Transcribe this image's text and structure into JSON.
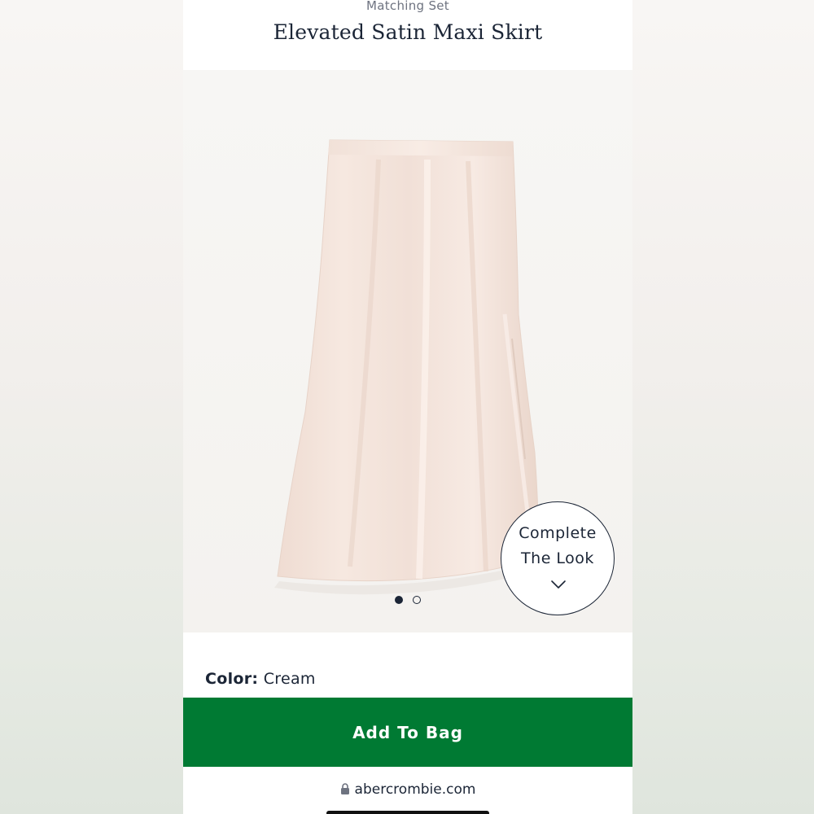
{
  "header": {
    "eyebrow": "Matching Set",
    "title": "Elevated Satin Maxi Skirt"
  },
  "gallery": {
    "image_icon": "cream-satin-maxi-skirt-image",
    "current_slide": 1,
    "total_slides": 2
  },
  "complete_look": {
    "line1": "Complete",
    "line2": "The Look",
    "icon": "chevron-down-icon"
  },
  "product": {
    "color_label": "Color:",
    "color_value": "Cream"
  },
  "add_to_bag": {
    "label": "Add To Bag",
    "color": "#007a33"
  },
  "browser": {
    "url": "abercrombie.com",
    "lock_icon": "lock-icon"
  },
  "colors": {
    "text": "#1b2536",
    "skirt": "#f3e4dc",
    "gallery_bg": "#f6f5f3"
  }
}
